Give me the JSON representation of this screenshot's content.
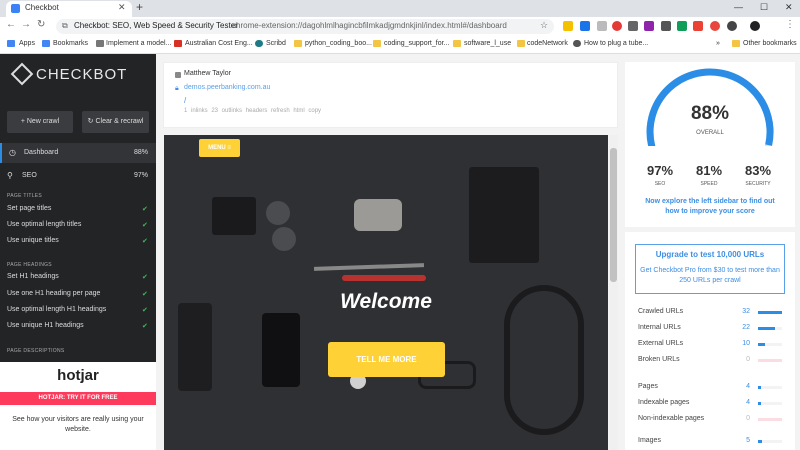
{
  "browser": {
    "tab_title": "Checkbot",
    "new_tab": "+",
    "window_min": "—",
    "window_max": "☐",
    "window_close": "✕",
    "page_title": "Checkbot: SEO, Web Speed & Security Tester",
    "url": "chrome-extension://dagohlmlhagincbfilmkadjgmdnkjinl/index.html#/dashboard",
    "bookmarks": [
      {
        "label": "Apps",
        "color": "#4285f4"
      },
      {
        "label": "Bookmarks",
        "color": "#4285f4"
      },
      {
        "label": "Implement a model...",
        "color": "#777777"
      },
      {
        "label": "Australian Cost Eng...",
        "color": "#d93025"
      },
      {
        "label": "Scribd",
        "color": "#1e7b85"
      },
      {
        "label": "python_coding_boo...",
        "color": "#f4c542"
      },
      {
        "label": "coding_support_for...",
        "color": "#f4c542"
      },
      {
        "label": "software_l_use",
        "color": "#f4c542"
      },
      {
        "label": "codeNetwork",
        "color": "#f4c542"
      },
      {
        "label": "How to plug a tube...",
        "color": "#555555"
      }
    ],
    "other_bookmarks": "Other bookmarks",
    "more": "»"
  },
  "sidebar": {
    "logo": "CHECKBOT",
    "new_crawl": "+ New crawl",
    "clear_recrawl": "↻ Clear & recrawl",
    "nav": [
      {
        "label": "Dashboard",
        "pct": "88%"
      },
      {
        "label": "SEO",
        "pct": "97%"
      }
    ],
    "sections": [
      {
        "title": "PAGE TITLES",
        "rules": [
          "Set page titles",
          "Use optimal length titles",
          "Use unique titles"
        ]
      },
      {
        "title": "PAGE HEADINGS",
        "rules": [
          "Set H1 headings",
          "Use one H1 heading per page",
          "Use optimal length H1 headings",
          "Use unique H1 headings"
        ]
      },
      {
        "title": "PAGE DESCRIPTIONS",
        "rules": []
      }
    ],
    "check": "✔"
  },
  "hotjar": {
    "logo": "hotjar",
    "cta": "HOTJAR: TRY IT FOR FREE",
    "desc": "See how your visitors are really using your website."
  },
  "site": {
    "user": "Matthew Taylor",
    "domain": "demos.peerbanking.com.au",
    "path": "/",
    "meta": "1 inlinks  23 outlinks  headers  refresh  html  copy"
  },
  "preview": {
    "menu": "MENU ≡",
    "welcome": "Welcome",
    "cta": "TELL ME MORE"
  },
  "scores": {
    "overall": "88%",
    "overall_label": "OVERALL",
    "overall_value": 0.88,
    "items": [
      {
        "pct": "97%",
        "label": "SEO"
      },
      {
        "pct": "81%",
        "label": "SPEED"
      },
      {
        "pct": "83%",
        "label": "SECURITY"
      }
    ],
    "explore": "Now explore the left sidebar to find out how to improve your score",
    "gauge_color": "#2b8de5",
    "gauge_track": "#d6e6f7"
  },
  "upgrade": {
    "title": "Upgrade to test 10,000 URLs",
    "sub": "Get Checkbot Pro from $30 to test more than 250 URLs per crawl"
  },
  "stats": [
    {
      "label": "Crawled URLs",
      "value": "32",
      "frac": 1.0
    },
    {
      "label": "Internal URLs",
      "value": "22",
      "frac": 0.69
    },
    {
      "label": "External URLs",
      "value": "10",
      "frac": 0.31
    },
    {
      "label": "Broken URLs",
      "value": "0",
      "frac": 0
    },
    {
      "label": "Pages",
      "value": "4",
      "frac": 0.13
    },
    {
      "label": "Indexable pages",
      "value": "4",
      "frac": 0.13
    },
    {
      "label": "Non-indexable pages",
      "value": "0",
      "frac": 0
    },
    {
      "label": "Images",
      "value": "5",
      "frac": 0.16
    }
  ]
}
